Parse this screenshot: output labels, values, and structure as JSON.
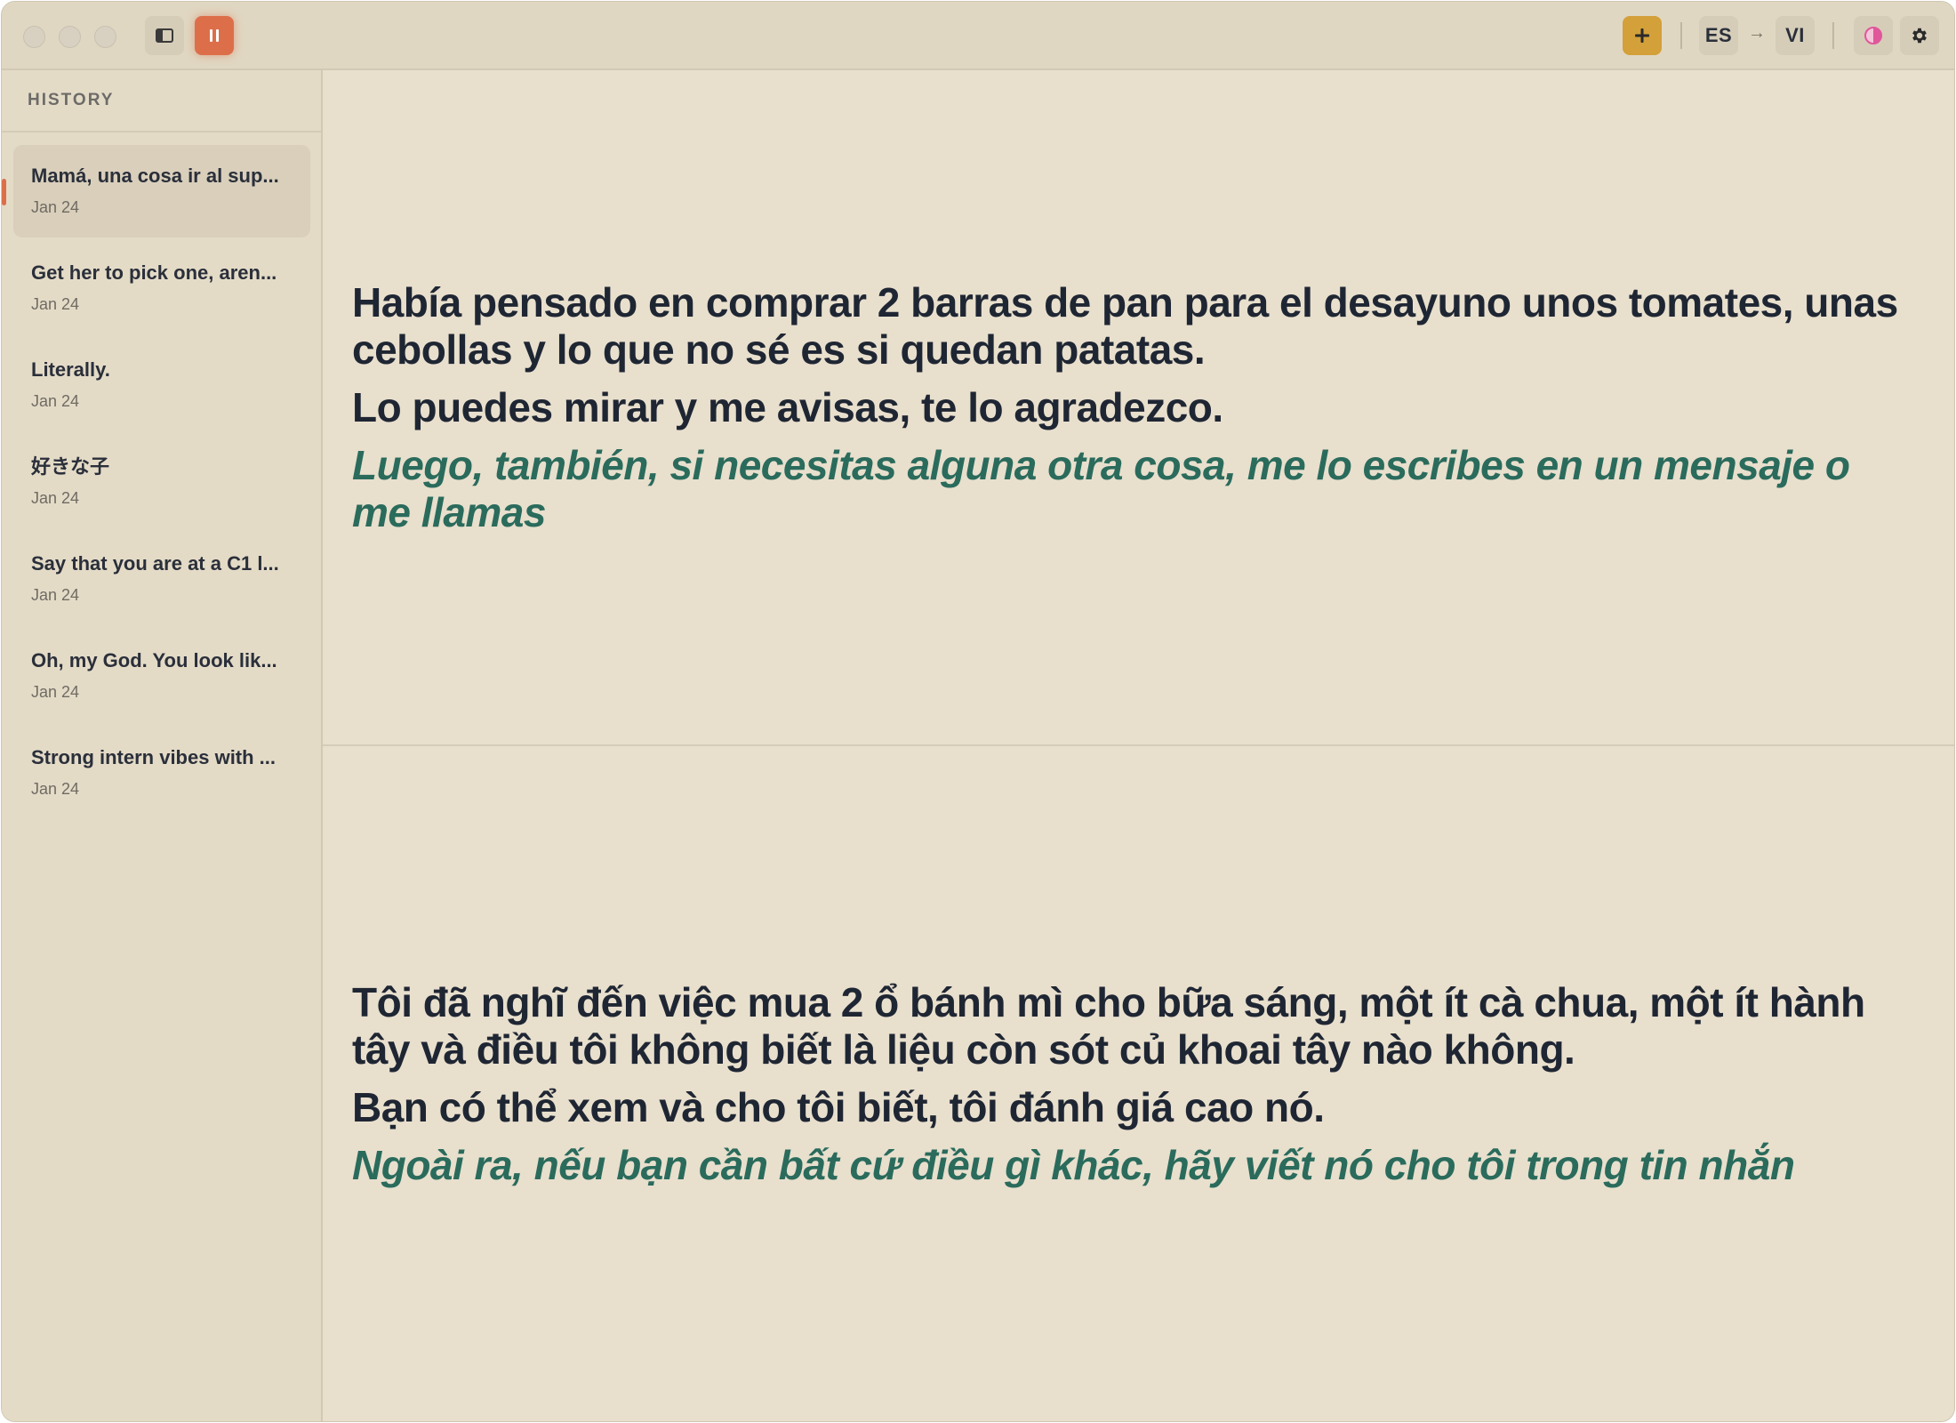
{
  "toolbar": {
    "source_lang": "ES",
    "target_lang": "VI",
    "arrow": "→",
    "add_label": "+"
  },
  "sidebar": {
    "header": "HISTORY",
    "items": [
      {
        "title": "Mamá, una cosa ir al sup...",
        "date": "Jan 24",
        "active": true
      },
      {
        "title": "Get her to pick one, aren...",
        "date": "Jan 24",
        "active": false
      },
      {
        "title": "Literally.",
        "date": "Jan 24",
        "active": false
      },
      {
        "title": "好きな子",
        "date": "Jan 24",
        "active": false
      },
      {
        "title": "Say that you are at a C1 l...",
        "date": "Jan 24",
        "active": false
      },
      {
        "title": "Oh, my God. You look lik...",
        "date": "Jan 24",
        "active": false
      },
      {
        "title": "Strong intern vibes with ...",
        "date": "Jan 24",
        "active": false
      }
    ]
  },
  "source": {
    "lines": [
      "Había pensado en comprar 2 barras de pan para el desayuno unos tomates, unas cebollas y lo que no sé es si quedan patatas.",
      "Lo puedes mirar y me avisas, te lo agradezco."
    ],
    "interim": "Luego, también, si necesitas alguna otra cosa, me lo escribes en un mensaje o me llamas"
  },
  "translation": {
    "lines": [
      "Tôi đã nghĩ đến việc mua 2 ổ bánh mì cho bữa sáng, một ít cà chua, một ít hành tây và điều tôi không biết là liệu còn sót củ khoai tây nào không.",
      "Bạn có thể xem và cho tôi biết, tôi đánh giá cao nó."
    ],
    "interim": "Ngoài ra, nếu bạn cần bất cứ điều gì khác, hãy viết nó cho tôi trong tin nhắn"
  },
  "icons": {
    "sidebar_toggle": "sidebar-toggle-icon",
    "pause": "pause-icon",
    "add": "plus-icon",
    "theme": "contrast-icon",
    "settings": "gear-icon"
  },
  "colors": {
    "background": "#e8dfcd",
    "accent_orange": "#dc6f4a",
    "accent_gold": "#d3a03a",
    "interim_green": "#2a6b5c",
    "text_dark": "#1f2633"
  }
}
